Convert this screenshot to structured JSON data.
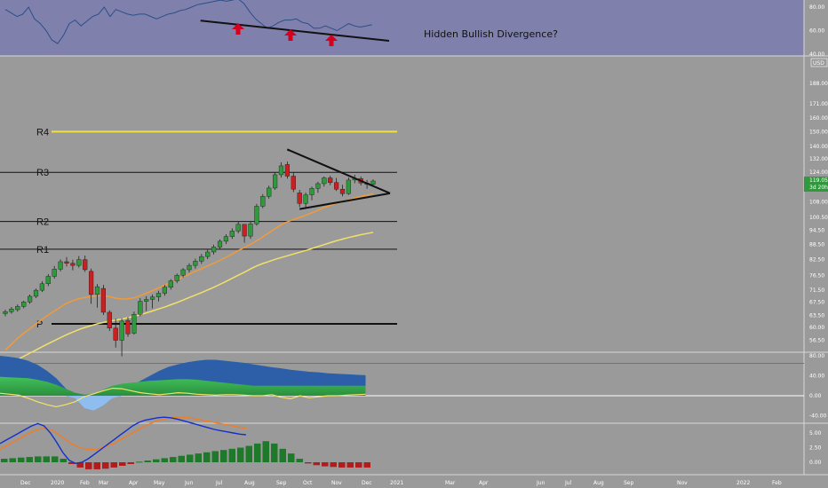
{
  "chart_data": {
    "type": "line",
    "title": "",
    "main": {
      "currency": "USD",
      "price_ticks": [
        "188.00",
        "171.00",
        "160.00",
        "150.00",
        "140.00",
        "132.00",
        "124.00",
        "116.00",
        "108.00",
        "100.50",
        "94.50",
        "88.50",
        "82.50",
        "76.50",
        "71.50",
        "67.50",
        "63.50",
        "60.00",
        "56.50"
      ],
      "last_price": "119.05",
      "countdown": "3d 20h",
      "levels": [
        {
          "name": "R4",
          "value": 150.0,
          "color": "#f0e040"
        },
        {
          "name": "R3",
          "value": 124.0,
          "color": "#111111"
        },
        {
          "name": "R2",
          "value": 98.5,
          "color": "#111111"
        },
        {
          "name": "R1",
          "value": 86.5,
          "color": "#111111"
        },
        {
          "name": "P",
          "value": 61.0,
          "color": "#111111"
        }
      ],
      "x_ticks": [
        "Dec",
        "2020",
        "Feb",
        "Mar",
        "Apr",
        "May",
        "Jun",
        "Jul",
        "Aug",
        "Sep",
        "Oct",
        "Nov",
        "Dec",
        "2021",
        "Mar",
        "Apr",
        "Jun",
        "Jul",
        "Aug",
        "Sep",
        "Nov",
        "2022",
        "Feb"
      ],
      "weekly_candles": [
        {
          "o": 64.0,
          "h": 65.2,
          "l": 63.2,
          "c": 64.6
        },
        {
          "o": 64.6,
          "h": 66.0,
          "l": 64.0,
          "c": 65.4
        },
        {
          "o": 65.2,
          "h": 66.8,
          "l": 64.6,
          "c": 66.2
        },
        {
          "o": 66.2,
          "h": 68.0,
          "l": 65.6,
          "c": 67.6
        },
        {
          "o": 67.6,
          "h": 70.0,
          "l": 67.0,
          "c": 69.4
        },
        {
          "o": 69.4,
          "h": 72.0,
          "l": 68.8,
          "c": 71.4
        },
        {
          "o": 71.4,
          "h": 74.5,
          "l": 70.8,
          "c": 73.6
        },
        {
          "o": 73.6,
          "h": 77.0,
          "l": 72.8,
          "c": 76.2
        },
        {
          "o": 76.2,
          "h": 80.0,
          "l": 75.4,
          "c": 78.8
        },
        {
          "o": 78.8,
          "h": 82.5,
          "l": 78.0,
          "c": 81.6
        },
        {
          "o": 81.6,
          "h": 83.4,
          "l": 79.8,
          "c": 81.0
        },
        {
          "o": 81.0,
          "h": 82.4,
          "l": 78.4,
          "c": 80.2
        },
        {
          "o": 80.2,
          "h": 83.8,
          "l": 79.4,
          "c": 82.4
        },
        {
          "o": 82.4,
          "h": 84.0,
          "l": 77.8,
          "c": 78.6
        },
        {
          "o": 78.0,
          "h": 79.0,
          "l": 67.0,
          "c": 70.0
        },
        {
          "o": 70.0,
          "h": 73.5,
          "l": 65.8,
          "c": 72.6
        },
        {
          "o": 72.0,
          "h": 73.2,
          "l": 63.6,
          "c": 64.4
        },
        {
          "o": 64.4,
          "h": 65.0,
          "l": 59.0,
          "c": 59.8
        },
        {
          "o": 59.8,
          "h": 62.5,
          "l": 54.6,
          "c": 56.5
        },
        {
          "o": 56.5,
          "h": 62.6,
          "l": 52.4,
          "c": 61.8
        },
        {
          "o": 62.0,
          "h": 63.0,
          "l": 57.4,
          "c": 58.2
        },
        {
          "o": 58.4,
          "h": 64.6,
          "l": 58.0,
          "c": 63.8
        },
        {
          "o": 63.8,
          "h": 68.8,
          "l": 63.2,
          "c": 67.8
        },
        {
          "o": 67.8,
          "h": 69.4,
          "l": 64.8,
          "c": 68.4
        },
        {
          "o": 68.4,
          "h": 70.0,
          "l": 65.6,
          "c": 69.2
        },
        {
          "o": 69.2,
          "h": 71.2,
          "l": 67.8,
          "c": 70.4
        },
        {
          "o": 70.4,
          "h": 73.2,
          "l": 69.6,
          "c": 72.4
        },
        {
          "o": 72.4,
          "h": 75.2,
          "l": 71.6,
          "c": 74.6
        },
        {
          "o": 74.6,
          "h": 77.2,
          "l": 73.8,
          "c": 76.6
        },
        {
          "o": 76.6,
          "h": 79.2,
          "l": 75.8,
          "c": 78.6
        },
        {
          "o": 78.6,
          "h": 81.0,
          "l": 77.6,
          "c": 80.2
        },
        {
          "o": 80.2,
          "h": 82.8,
          "l": 79.0,
          "c": 81.8
        },
        {
          "o": 81.8,
          "h": 84.6,
          "l": 80.8,
          "c": 83.6
        },
        {
          "o": 83.6,
          "h": 86.4,
          "l": 82.6,
          "c": 85.4
        },
        {
          "o": 85.4,
          "h": 88.4,
          "l": 84.4,
          "c": 87.4
        },
        {
          "o": 87.4,
          "h": 90.6,
          "l": 86.6,
          "c": 89.8
        },
        {
          "o": 89.8,
          "h": 92.8,
          "l": 88.6,
          "c": 91.8
        },
        {
          "o": 91.8,
          "h": 95.4,
          "l": 90.8,
          "c": 94.2
        },
        {
          "o": 94.2,
          "h": 98.4,
          "l": 93.2,
          "c": 97.2
        },
        {
          "o": 97.2,
          "h": 96.0,
          "l": 89.2,
          "c": 92.0
        },
        {
          "o": 92.0,
          "h": 98.6,
          "l": 90.8,
          "c": 97.4
        },
        {
          "o": 97.4,
          "h": 107.0,
          "l": 96.6,
          "c": 105.8
        },
        {
          "o": 105.8,
          "h": 112.0,
          "l": 104.8,
          "c": 110.8
        },
        {
          "o": 110.8,
          "h": 116.5,
          "l": 109.6,
          "c": 115.2
        },
        {
          "o": 115.2,
          "h": 124.0,
          "l": 114.2,
          "c": 122.6
        },
        {
          "o": 122.6,
          "h": 130.0,
          "l": 121.0,
          "c": 127.8
        },
        {
          "o": 128.6,
          "h": 130.4,
          "l": 120.4,
          "c": 121.8
        },
        {
          "o": 121.8,
          "h": 124.0,
          "l": 113.0,
          "c": 114.6
        },
        {
          "o": 112.6,
          "h": 114.2,
          "l": 105.4,
          "c": 107.2
        },
        {
          "o": 107.2,
          "h": 112.8,
          "l": 104.6,
          "c": 111.6
        },
        {
          "o": 111.6,
          "h": 116.0,
          "l": 108.8,
          "c": 115.0
        },
        {
          "o": 115.0,
          "h": 118.6,
          "l": 112.6,
          "c": 117.6
        },
        {
          "o": 117.6,
          "h": 121.6,
          "l": 116.0,
          "c": 120.8
        },
        {
          "o": 120.8,
          "h": 122.0,
          "l": 116.8,
          "c": 118.2
        },
        {
          "o": 118.2,
          "h": 120.8,
          "l": 113.6,
          "c": 114.6
        },
        {
          "o": 114.6,
          "h": 117.0,
          "l": 110.8,
          "c": 112.2
        },
        {
          "o": 112.2,
          "h": 121.0,
          "l": 111.6,
          "c": 119.6
        },
        {
          "o": 119.6,
          "h": 122.6,
          "l": 117.8,
          "c": 120.4
        },
        {
          "o": 120.4,
          "h": 121.6,
          "l": 116.6,
          "c": 118.0
        },
        {
          "o": 118.0,
          "h": 119.6,
          "l": 114.8,
          "c": 117.2
        },
        {
          "o": 117.2,
          "h": 120.0,
          "l": 116.2,
          "c": 119.05
        }
      ],
      "ma_fast": [
        54,
        55.5,
        57,
        58.4,
        59.6,
        61,
        62.3,
        63.6,
        64.8,
        66,
        67.2,
        68,
        68.6,
        69,
        69.3,
        69.6,
        69.6,
        69.3,
        68.8,
        68.5,
        68.6,
        68.9,
        69.6,
        70.4,
        71.3,
        72.2,
        73.1,
        74.1,
        75.0,
        76.0,
        77.0,
        78.0,
        79.0,
        80.0,
        81.0,
        82.1,
        83.3,
        84.6,
        86.0,
        87.2,
        88.5,
        90.0,
        91.7,
        93.4,
        95.2,
        97.0,
        98.3,
        99.4,
        100.4,
        101.4,
        102.6,
        103.8,
        105.2,
        106.2,
        107.2,
        108.0,
        109.0,
        110.0,
        110.8,
        111.5,
        112.2
      ],
      "ma_slow": [
        50,
        50.8,
        51.6,
        52.4,
        53.2,
        54.0,
        54.8,
        55.6,
        56.4,
        57.2,
        58.0,
        58.7,
        59.4,
        60.0,
        60.5,
        61.0,
        61.4,
        61.8,
        62.1,
        62.4,
        62.8,
        63.2,
        63.7,
        64.2,
        64.8,
        65.4,
        66.0,
        66.7,
        67.4,
        68.2,
        69.0,
        69.8,
        70.6,
        71.5,
        72.4,
        73.4,
        74.4,
        75.5,
        76.6,
        77.7,
        78.9,
        80.0,
        80.9,
        81.7,
        82.5,
        83.2,
        83.9,
        84.6,
        85.3,
        86.0,
        86.8,
        87.6,
        88.4,
        89.2,
        90.0,
        90.7,
        91.4,
        92.0,
        92.6,
        93.1,
        93.6
      ],
      "triangle": {
        "upper": [
          [
            46,
            138
          ],
          [
            63,
            112.4
          ]
        ],
        "lower": [
          [
            48,
            104.4
          ],
          [
            63,
            112.4
          ]
        ]
      },
      "trend_bullish_arrow": true
    },
    "top_oscillator": {
      "ticks": [
        "80.00",
        "60.00",
        "40.00"
      ],
      "values": [
        78,
        75,
        72,
        74,
        80,
        70,
        66,
        60,
        52,
        49,
        56,
        66,
        69,
        64,
        68,
        72,
        74,
        80,
        72,
        78,
        76,
        74,
        73,
        74,
        74,
        72,
        70,
        72,
        74,
        75,
        77,
        78,
        80,
        82,
        83,
        84,
        85,
        86,
        85,
        86,
        87,
        83,
        76,
        70,
        66,
        62,
        64,
        67,
        69,
        69,
        70,
        67,
        66,
        62,
        62,
        64,
        62,
        60,
        63,
        66,
        64,
        63,
        64,
        65
      ],
      "annotation": "Hidden Bullish Divergence?",
      "trend_line": [
        [
          34,
          70.0
        ],
        [
          56,
          54.5
        ]
      ],
      "arrow_points": [
        34,
        45,
        52
      ]
    },
    "mid_oscillator": {
      "ticks": [
        "80.00",
        "40.00",
        "0.00",
        "-40.00"
      ],
      "h_lines": [
        65,
        0
      ],
      "blue_band": [
        80,
        78,
        75,
        70,
        62,
        50,
        35,
        15,
        -5,
        -25,
        -30,
        -20,
        -5,
        10,
        20,
        30,
        40,
        50,
        58,
        63,
        67,
        70,
        72,
        72,
        70,
        68,
        66,
        63,
        60,
        57,
        55,
        52,
        50,
        48,
        47,
        45,
        44,
        43,
        42,
        41
      ],
      "green_band": [
        38,
        37,
        36,
        35,
        32,
        28,
        22,
        14,
        6,
        2,
        4,
        12,
        20,
        24,
        26,
        28,
        30,
        31,
        32,
        33,
        33,
        32,
        30,
        28,
        26,
        24,
        22,
        20,
        20,
        20,
        20,
        20,
        20,
        20,
        20,
        20,
        20,
        20,
        20,
        20
      ],
      "yellow_line": [
        5,
        3,
        1,
        -5,
        -12,
        -18,
        -22,
        -18,
        -12,
        -2,
        4,
        10,
        15,
        14,
        10,
        6,
        4,
        2,
        4,
        6,
        5,
        3,
        2,
        1,
        2,
        2,
        1,
        0,
        0,
        2,
        -3,
        -6,
        0,
        -4,
        -2,
        0,
        0,
        1,
        2,
        3
      ]
    },
    "bottom_oscillator": {
      "ticks": [
        "5.00",
        "2.50",
        "0.00"
      ],
      "blue_line": [
        3.2,
        3.8,
        4.4,
        5.0,
        5.6,
        6.2,
        6.6,
        6.2,
        5.0,
        3.4,
        1.6,
        0.3,
        -0.2,
        0.0,
        0.6,
        1.4,
        2.2,
        3.0,
        3.8,
        4.6,
        5.4,
        6.2,
        6.8,
        7.2,
        7.4,
        7.6,
        7.7,
        7.6,
        7.4,
        7.1,
        6.8,
        6.5,
        6.2,
        5.9,
        5.6,
        5.4,
        5.2,
        5.0,
        4.8,
        4.7
      ],
      "orange_line": [
        2.2,
        2.8,
        3.4,
        4.0,
        4.6,
        5.2,
        5.6,
        5.8,
        5.6,
        5.0,
        4.2,
        3.4,
        2.8,
        2.4,
        2.2,
        2.2,
        2.4,
        2.8,
        3.2,
        3.8,
        4.4,
        5.0,
        5.6,
        6.2,
        6.7,
        7.1,
        7.4,
        7.6,
        7.7,
        7.7,
        7.6,
        7.4,
        7.2,
        7.0,
        6.8,
        6.6,
        6.4,
        6.2,
        6.0,
        5.8
      ],
      "histogram": [
        0.6,
        0.7,
        0.8,
        0.9,
        1.0,
        1.0,
        1.0,
        0.6,
        -0.3,
        -0.9,
        -1.2,
        -1.2,
        -1.1,
        -0.9,
        -0.6,
        -0.3,
        0.1,
        0.3,
        0.5,
        0.7,
        0.9,
        1.1,
        1.3,
        1.5,
        1.7,
        1.9,
        2.1,
        2.3,
        2.5,
        2.8,
        3.2,
        3.6,
        3.2,
        2.3,
        1.5,
        0.6,
        -0.2,
        -0.5,
        -0.7,
        -0.8,
        -0.9,
        -0.9,
        -0.9,
        -0.9
      ]
    }
  }
}
